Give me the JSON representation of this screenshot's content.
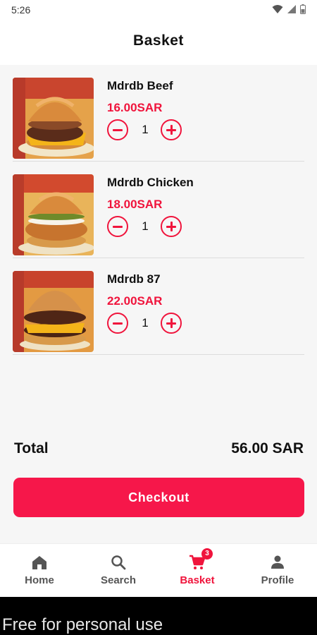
{
  "status_bar": {
    "time": "5:26"
  },
  "header": {
    "title": "Basket"
  },
  "items": [
    {
      "name": "Mdrdb Beef",
      "price": "16.00SAR",
      "quantity": "1"
    },
    {
      "name": "Mdrdb Chicken",
      "price": "18.00SAR",
      "quantity": "1"
    },
    {
      "name": "Mdrdb 87",
      "price": "22.00SAR",
      "quantity": "1"
    }
  ],
  "summary": {
    "total_label": "Total",
    "total_value": "56.00 SAR"
  },
  "checkout_label": "Checkout",
  "nav": {
    "home": "Home",
    "search": "Search",
    "basket": "Basket",
    "basket_badge": "3",
    "profile": "Profile"
  },
  "footer_text": "Free for personal use",
  "colors": {
    "accent": "#f0143c",
    "button": "#f6174a"
  }
}
